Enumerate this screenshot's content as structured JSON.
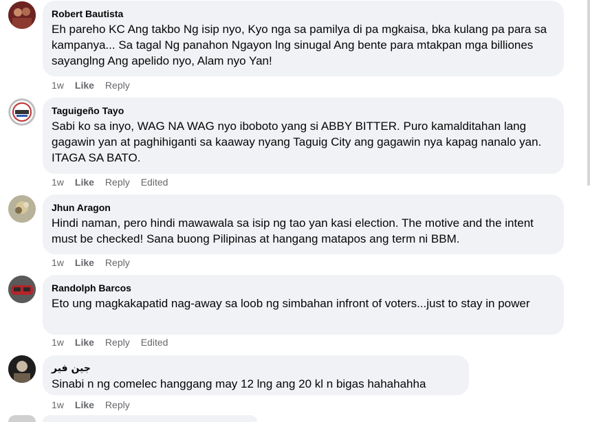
{
  "actions": {
    "like": "Like",
    "reply": "Reply",
    "edited": "Edited"
  },
  "comments": [
    {
      "author": "Robert Bautista",
      "text": "Eh pareho KC Ang takbo Ng isip nyo, Kyo nga sa pamilya di pa mgkaisa, bka kulang pa para sa kampanya... Sa tagal Ng panahon Ngayon lng sinugal Ang bente para mtakpan mga billiones sayanglng Ang apelido nyo, Alam nyo Yan!",
      "time": "1w",
      "edited": false
    },
    {
      "author": "Taguigeño Tayo",
      "text": "Sabi ko sa inyo, WAG NA WAG nyo iboboto yang si ABBY BITTER. Puro kamalditahan lang gagawin yan at paghihiganti sa kaaway nyang Taguig City ang gagawin nya kapag nanalo yan. ITAGA SA BATO.",
      "time": "1w",
      "edited": true
    },
    {
      "author": "Jhun Aragon",
      "text": "Hindi naman, pero hindi mawawala sa isip ng tao yan kasi election. The motive and the intent must be checked! Sana buong Pilipinas at hangang matapos ang term ni BBM.",
      "time": "1w",
      "edited": false
    },
    {
      "author": "Randolph Barcos",
      "text": "Eto ung magkakapatid nag-away sa loob ng simbahan infront of voters...just to stay in power",
      "time": "1w",
      "edited": true
    },
    {
      "author": "جين فير",
      "text": "Sinabi n ng comelec hanggang may 12 lng ang 20 kl n bigas hahahahha",
      "time": "1w",
      "edited": false
    }
  ]
}
